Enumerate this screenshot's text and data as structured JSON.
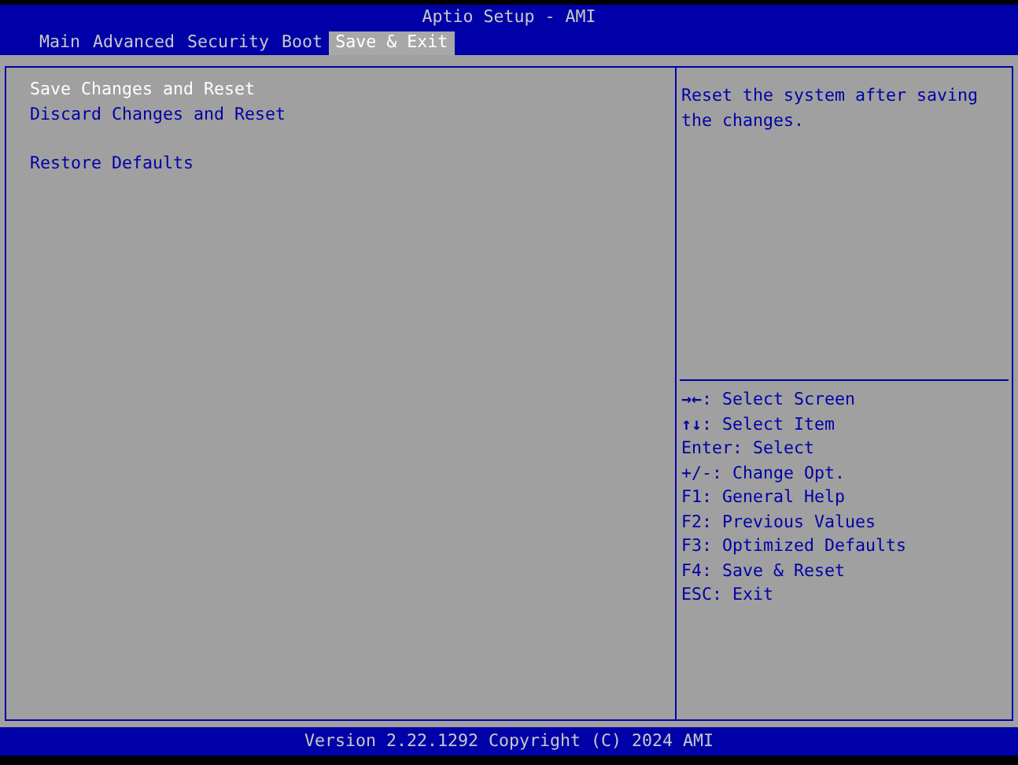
{
  "window": {
    "title": "Aptio Setup - AMI"
  },
  "tabs": [
    {
      "label": "Main",
      "selected": false
    },
    {
      "label": "Advanced",
      "selected": false
    },
    {
      "label": "Security",
      "selected": false
    },
    {
      "label": "Boot",
      "selected": false
    },
    {
      "label": "Save & Exit",
      "selected": true
    }
  ],
  "menu_items": [
    {
      "label": "Save Changes and Reset",
      "selected": true
    },
    {
      "label": "Discard Changes and Reset",
      "selected": false
    },
    {
      "kind": "spacer"
    },
    {
      "label": "Restore Defaults",
      "selected": false
    }
  ],
  "help_text": "Reset the system after saving the changes.",
  "key_legend": [
    "**→←**: Select Screen",
    "**↑↓**: Select Item",
    "Enter: Select",
    "+/-: Change Opt.",
    "F1: General Help",
    "F2: Previous Values",
    "F3: Optimized Defaults",
    "F4: Save & Reset",
    "ESC: Exit"
  ],
  "status_bar": "Version 2.22.1292 Copyright (C) 2024 AMI"
}
